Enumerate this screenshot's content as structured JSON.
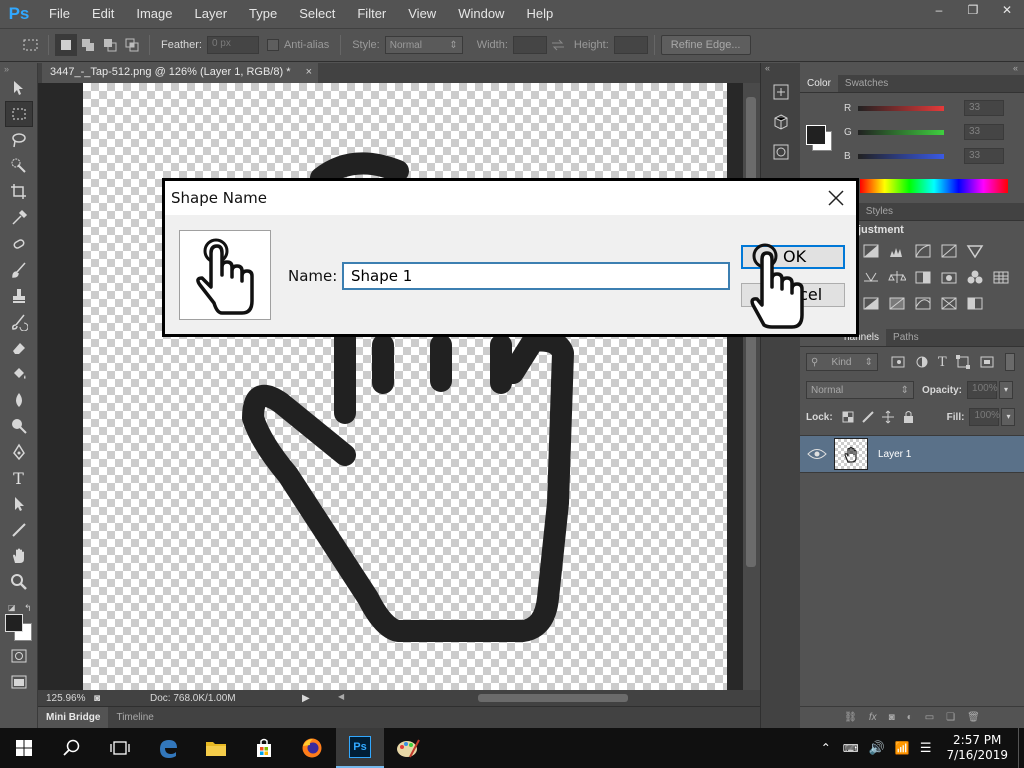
{
  "app": {
    "logo": "Ps",
    "menu": [
      "File",
      "Edit",
      "Image",
      "Layer",
      "Type",
      "Select",
      "Filter",
      "View",
      "Window",
      "Help"
    ],
    "window_controls": {
      "minimize": "–",
      "restore": "❐",
      "close": "✕"
    }
  },
  "options_bar": {
    "feather_label": "Feather:",
    "feather_value": "0 px",
    "antialias_label": "Anti-alias",
    "style_label": "Style:",
    "style_value": "Normal",
    "width_label": "Width:",
    "height_label": "Height:",
    "refine_edge_label": "Refine Edge..."
  },
  "document": {
    "tab_title": "3447_-_Tap-512.png @ 126% (Layer 1, RGB/8) *",
    "tab_close": "×",
    "zoom": "125.96%",
    "doc_info": "Doc: 768.0K/1.00M"
  },
  "bottom_panels": {
    "tabs": [
      "Mini Bridge",
      "Timeline"
    ]
  },
  "color_panel": {
    "tabs": [
      "Color",
      "Swatches"
    ],
    "channels": [
      {
        "label": "R",
        "value": "33"
      },
      {
        "label": "G",
        "value": "33"
      },
      {
        "label": "B",
        "value": "33"
      }
    ],
    "channel_colors": {
      "R": "#e53a3a",
      "G": "#3fcf3f",
      "B": "#3a5ae5"
    }
  },
  "adjustments_panel": {
    "tabs": [
      "ts",
      "Styles"
    ],
    "title": "justment"
  },
  "layers_panel": {
    "tabs": [
      "hannels",
      "Paths"
    ],
    "kind_label": "Kind",
    "blend_mode": "Normal",
    "opacity_label": "Opacity:",
    "opacity_value": "100%",
    "lock_label": "Lock:",
    "fill_label": "Fill:",
    "fill_value": "100%",
    "layers": [
      {
        "name": "Layer 1",
        "visible": true,
        "selected": true
      }
    ]
  },
  "dialog": {
    "title": "Shape Name",
    "name_label": "Name:",
    "name_value": "Shape 1",
    "ok_label": "OK",
    "cancel_label": "Cancel"
  },
  "taskbar": {
    "time": "2:57 PM",
    "date": "7/16/2019",
    "active_app": "Ps"
  },
  "colors": {
    "ps_blue": "#31a8ff",
    "selected_layer": "#5a7189",
    "dialog_focus": "#0078d7"
  }
}
